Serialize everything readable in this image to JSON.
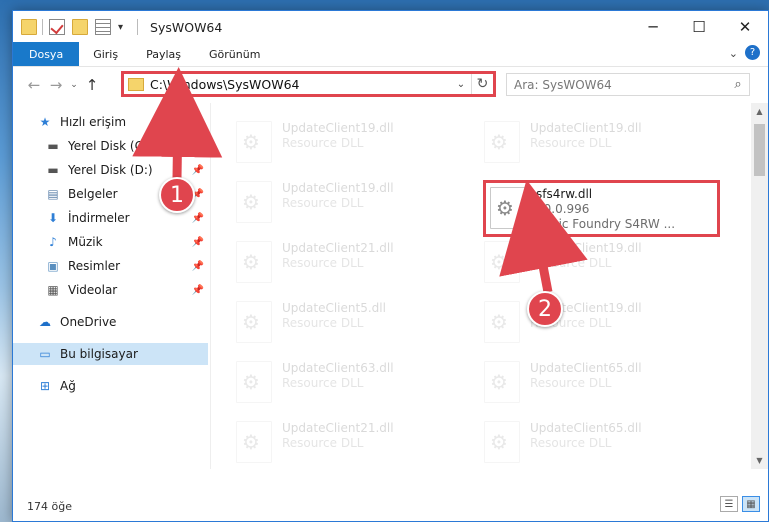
{
  "window": {
    "title": "SysWOW64",
    "min": "─",
    "max": "☐",
    "close": "✕"
  },
  "ribbon": {
    "tabs": [
      "Dosya",
      "Giriş",
      "Paylaş",
      "Görünüm"
    ],
    "expand": "⌄",
    "help": "?"
  },
  "nav": {
    "back": "←",
    "forward": "→",
    "recent": "⌄",
    "up": "↑"
  },
  "address": {
    "path": "C:\\Windows\\SysWOW64",
    "dropdown": "⌄",
    "refresh": "↻"
  },
  "search": {
    "placeholder": "Ara: SysWOW64",
    "icon": "search-icon"
  },
  "sidebar": {
    "items": [
      {
        "label": "Hızlı erişim",
        "icon": "star-icon",
        "pinned": false
      },
      {
        "label": "Yerel Disk (C:)",
        "icon": "drive-icon",
        "pinned": true
      },
      {
        "label": "Yerel Disk (D:)",
        "icon": "drive-icon",
        "pinned": true
      },
      {
        "label": "Belgeler",
        "icon": "documents-icon",
        "pinned": true
      },
      {
        "label": "İndirmeler",
        "icon": "downloads-icon",
        "pinned": true
      },
      {
        "label": "Müzik",
        "icon": "music-icon",
        "pinned": true
      },
      {
        "label": "Resimler",
        "icon": "pictures-icon",
        "pinned": true
      },
      {
        "label": "Videolar",
        "icon": "videos-icon",
        "pinned": true
      },
      {
        "label": "OneDrive",
        "icon": "cloud-icon",
        "pinned": false
      },
      {
        "label": "Bu bilgisayar",
        "icon": "computer-icon",
        "pinned": false,
        "selected": true
      },
      {
        "label": "Ağ",
        "icon": "network-icon",
        "pinned": false
      }
    ]
  },
  "files": [
    {
      "name": "UpdateClient19.dll",
      "type": "Resource DLL"
    },
    {
      "name": "UpdateClient19.dll",
      "type": "Resource DLL"
    },
    {
      "name": "UpdateClient19.dll",
      "type": "Resource DLL"
    },
    {
      "name": "UpdateClient21.dll",
      "type": "Resource DLL"
    },
    {
      "name": "UpdateClient19.dll",
      "type": "Resource DLL"
    },
    {
      "name": "UpdateClient5.dll",
      "type": "Resource DLL"
    },
    {
      "name": "UpdateClient19.dll",
      "type": "Resource DLL"
    },
    {
      "name": "UpdateClient63.dll",
      "type": "Resource DLL"
    },
    {
      "name": "UpdateClient65.dll",
      "type": "Resource DLL"
    },
    {
      "name": "UpdateClient21.dll",
      "type": "Resource DLL"
    },
    {
      "name": "UpdateClient65.dll",
      "type": "Resource DLL"
    }
  ],
  "highlighted_file": {
    "name": "sfs4rw.dll",
    "version": "10.0.996",
    "description": "Sonic Foundry S4RW ..."
  },
  "callouts": [
    "1",
    "2"
  ],
  "status": {
    "count": "174 öğe"
  },
  "colors": {
    "accent": "#1979ca",
    "highlight": "#e0454e",
    "selection": "#cce4f7"
  }
}
